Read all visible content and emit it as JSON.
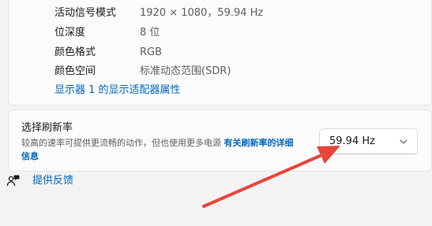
{
  "display_info": {
    "rows": [
      {
        "key": "活动信号模式",
        "value": "1920 × 1080，59.94 Hz"
      },
      {
        "key": "位深度",
        "value": "8 位"
      },
      {
        "key": "颜色格式",
        "value": "RGB"
      },
      {
        "key": "颜色空间",
        "value": "标准动态范围(SDR)"
      }
    ],
    "adapter_link": "显示器 1 的显示适配器属性"
  },
  "refresh_rate": {
    "title": "选择刷新率",
    "description": "较高的速率可提供更流畅的动作，但也使用更多电源",
    "more_info_link": "有关刷新率的详细信息",
    "selected": "59.94 Hz"
  },
  "feedback": {
    "label": "提供反馈"
  },
  "annotation": {
    "arrow_color": "#e8453c"
  }
}
